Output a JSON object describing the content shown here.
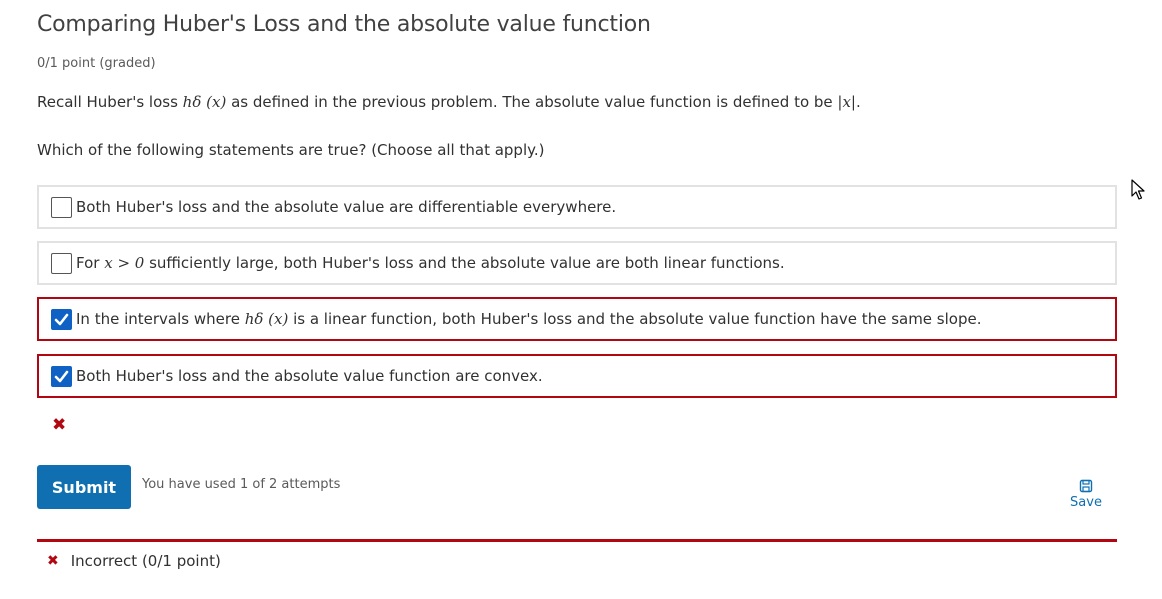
{
  "problem": {
    "title": "Comparing Huber's Loss and the absolute value function",
    "points": "0/1 point (graded)",
    "recall_prefix": "Recall Huber's loss ",
    "huber_math": "hδ (x)",
    "recall_middle": " as defined in the previous problem. The absolute value function is defined to be ",
    "abs_math": "|x|",
    "recall_suffix": ".",
    "question": "Which of the following statements are true? (Choose all that apply.)"
  },
  "choices": [
    {
      "checked": false,
      "text": "Both Huber's loss and the absolute value are differentiable everywhere."
    },
    {
      "checked": false,
      "prefix": "For ",
      "math": "x > 0",
      "text": " sufficiently large, both Huber's loss and the absolute value are both linear functions."
    },
    {
      "checked": true,
      "prefix": "In the intervals where ",
      "math": "hδ (x)",
      "text": " is a linear function, both Huber's loss and the absolute value function have the same slope."
    },
    {
      "checked": true,
      "text": "Both Huber's loss and the absolute value function are convex."
    }
  ],
  "status": {
    "result_icon": "✖",
    "color_incorrect": "#b20610"
  },
  "actions": {
    "submit_label": "Submit",
    "attempts_text": "You have used 1 of 2 attempts",
    "save_label": "Save"
  },
  "notification": {
    "icon": "✖",
    "text": "Incorrect (0/1 point)"
  },
  "colors": {
    "accent": "#0f6fb1",
    "checkbox": "#0f62c4",
    "border": "#e2e2e2"
  }
}
